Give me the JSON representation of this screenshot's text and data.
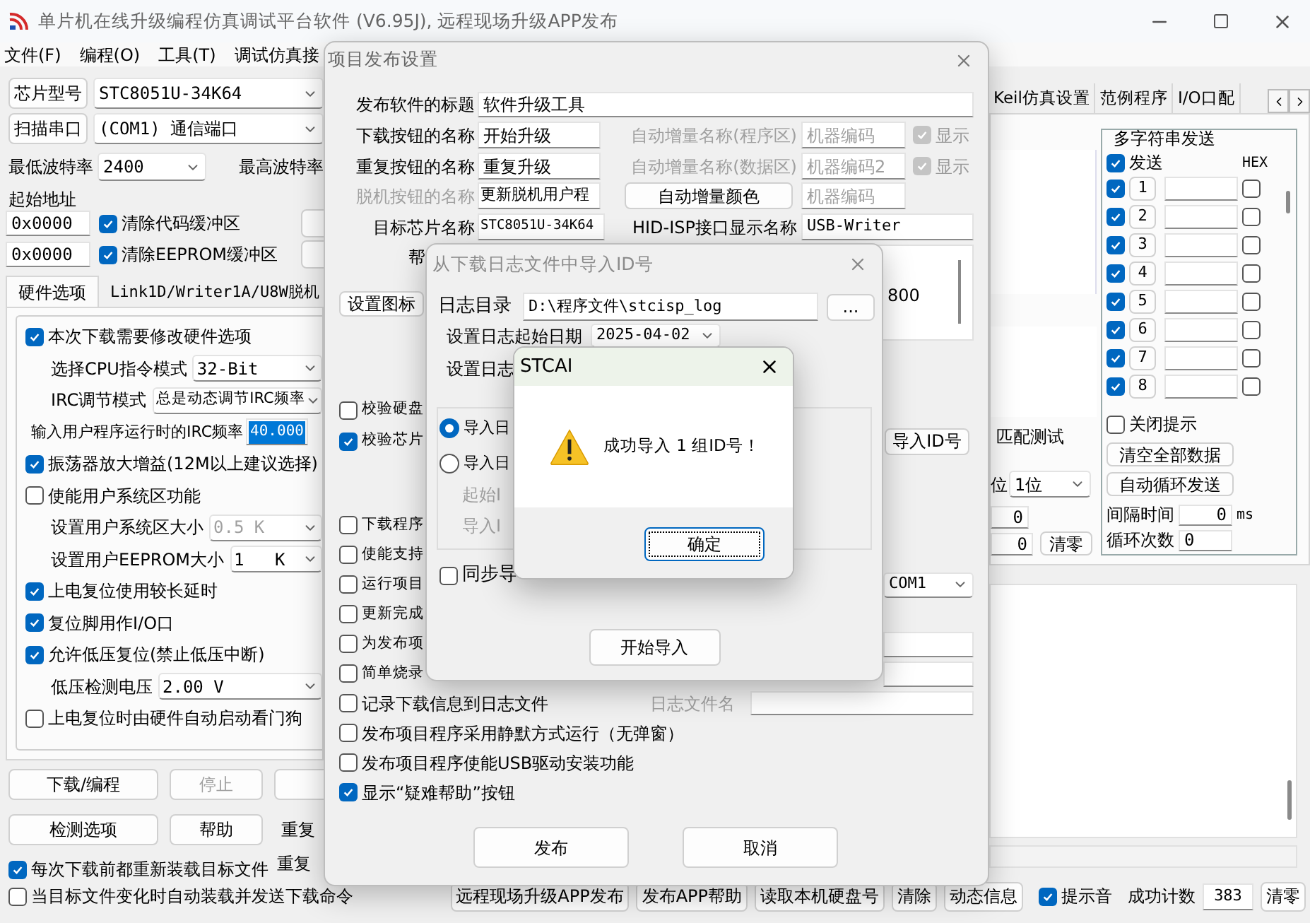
{
  "window": {
    "title": "单片机在线升级编程仿真调试平台软件 (V6.95J), 远程现场升级APP发布"
  },
  "menu": [
    "文件(F)",
    "编程(O)",
    "工具(T)",
    "调试仿真接"
  ],
  "left": {
    "chip": {
      "button": "芯片型号",
      "value": "STC8051U-34K64"
    },
    "port": {
      "button": "扫描串口",
      "value": "(COM1) 通信端口"
    },
    "min_baud": {
      "label": "最低波特率",
      "value": "2400"
    },
    "max_baud_label": "最高波特率",
    "start_address_label": "起始地址",
    "address_rows": [
      {
        "value": "0x0000",
        "label": "清除代码缓冲区",
        "checked": true
      },
      {
        "value": "0x0000",
        "label": "清除EEPROM缓冲区",
        "checked": true
      }
    ],
    "tabs": [
      {
        "label": "硬件选项",
        "selected": true
      },
      {
        "label": "Link1D/Writer1A/U8W脱机",
        "selected": false
      }
    ],
    "options": [
      {
        "kind": "checkbox",
        "label": "本次下载需要修改硬件选项",
        "checked": true
      },
      {
        "kind": "select",
        "label": "选择CPU指令模式",
        "value": "32-Bit",
        "disabled": false
      },
      {
        "kind": "select",
        "label": "IRC调节模式",
        "value": "总是动态调节IRC频率",
        "disabled": false
      },
      {
        "kind": "input",
        "label": "输入用户程序运行时的IRC频率",
        "value": "40.000",
        "selected": true
      },
      {
        "kind": "checkbox",
        "label": "振荡器放大增益(12M以上建议选择)",
        "checked": true
      },
      {
        "kind": "checkbox",
        "label": "使能用户系统区功能",
        "checked": false
      },
      {
        "kind": "select",
        "label": "设置用户系统区大小",
        "value": "0.5 K",
        "disabled": true
      },
      {
        "kind": "select",
        "label": "设置用户EEPROM大小",
        "value": "1   K",
        "disabled": false
      },
      {
        "kind": "checkbox",
        "label": "上电复位使用较长延时",
        "checked": true
      },
      {
        "kind": "checkbox",
        "label": "复位脚用作I/O口",
        "checked": true
      },
      {
        "kind": "checkbox",
        "label": "允许低压复位(禁止低压中断)",
        "checked": true
      },
      {
        "kind": "select",
        "label": "低压检测电压",
        "value": "2.00 V",
        "disabled": false
      },
      {
        "kind": "checkbox",
        "label": "上电复位时由硬件自动启动看门狗",
        "checked": false
      }
    ],
    "action_rows": [
      [
        {
          "label": "下载/编程",
          "disabled": false
        },
        {
          "label": "停止",
          "disabled": true
        }
      ],
      [
        {
          "label": "检测选项",
          "disabled": false
        },
        {
          "label": "帮助",
          "disabled": false
        }
      ]
    ],
    "side_labels": [
      "重复",
      "重复"
    ],
    "reload": {
      "label": "每次下载前都重新装载目标文件",
      "checked": true
    },
    "auto_send": {
      "label": "当目标文件变化时自动装载并发送下载命令",
      "checked": false
    }
  },
  "right": {
    "tabs": [
      {
        "label": "Keil仿真设置",
        "selected": false
      },
      {
        "label": "范例程序",
        "selected": false
      },
      {
        "label": "I/O口配",
        "selected": false
      }
    ],
    "match_label": "匹配测试",
    "bits_label": "位",
    "bits_value": "1位",
    "counters": [
      "0",
      "0"
    ],
    "clear_button": "清零",
    "multi": {
      "title": "多字符串发送",
      "send": {
        "label": "发送",
        "checked": true
      },
      "hex_label": "HEX",
      "rows": [
        {
          "number": "1",
          "checked": true,
          "hex": false
        },
        {
          "number": "2",
          "checked": true,
          "hex": false
        },
        {
          "number": "3",
          "checked": true,
          "hex": false
        },
        {
          "number": "4",
          "checked": true,
          "hex": false
        },
        {
          "number": "5",
          "checked": true,
          "hex": false
        },
        {
          "number": "6",
          "checked": true,
          "hex": false
        },
        {
          "number": "7",
          "checked": true,
          "hex": false
        },
        {
          "number": "8",
          "checked": true,
          "hex": false
        }
      ],
      "close_tip": {
        "label": "关闭提示",
        "checked": false
      },
      "buttons": [
        "清空全部数据",
        "自动循环发送"
      ],
      "interval": {
        "label": "间隔时间",
        "value": "0",
        "unit": "ms"
      },
      "loops": {
        "label": "循环次数",
        "value": "0"
      }
    }
  },
  "bottom_bar": {
    "buttons": [
      "远程现场升级APP发布",
      "发布APP帮助",
      "读取本机硬盘号",
      "清除",
      "动态信息"
    ],
    "sound": {
      "label": "提示音",
      "checked": true
    },
    "count_label": "成功计数",
    "count": "383",
    "clear": "清零"
  },
  "publish_dialog": {
    "title": "项目发布设置",
    "title_row": {
      "label": "发布软件的标题",
      "value": "软件升级工具"
    },
    "name_rows": [
      {
        "label": "下载按钮的名称",
        "value": "开始升级",
        "auto_label": "自动增量名称(程序区)",
        "auto_value": "机器编码",
        "show": {
          "label": "显示",
          "checked": true
        }
      },
      {
        "label": "重复按钮的名称",
        "value": "重复升级",
        "auto_label": "自动增量名称(数据区)",
        "auto_value": "机器编码2",
        "show": {
          "label": "显示",
          "checked": true
        }
      }
    ],
    "offline_row": {
      "label": "脱机按钮的名称",
      "value": "更新脱机用户程",
      "color_button": "自动增量颜色",
      "color_value": "机器编码"
    },
    "chip_row": {
      "label": "目标芯片名称",
      "value": "STC8051U-34K64",
      "hid_label": "HID-ISP接口显示名称",
      "hid_value": "USB-Writer"
    },
    "help_label": "帮",
    "help_text": "800",
    "icon_button": "设置图标",
    "verify": [
      {
        "label": "校验硬盘",
        "checked": false
      },
      {
        "label": "校验芯片",
        "checked": true
      }
    ],
    "import_button": "导入ID号",
    "options": [
      {
        "kind": "checkbox",
        "label": "下载程序",
        "checked": false
      },
      {
        "kind": "checkbox",
        "label": "使能支持",
        "checked": false
      },
      {
        "kind": "select",
        "label": "运行项目",
        "checked": false,
        "value": "COM1"
      },
      {
        "kind": "checkbox",
        "label": "更新完成",
        "checked": false
      },
      {
        "kind": "field",
        "label": "为发布项",
        "checked": false
      },
      {
        "kind": "field",
        "label": "简单烧录",
        "checked": false
      }
    ],
    "log": {
      "label": "记录下载信息到日志文件",
      "checked": false,
      "file_label": "日志文件名"
    },
    "more": [
      {
        "label": "发布项目程序采用静默方式运行（无弹窗）",
        "checked": false
      },
      {
        "label": "发布项目程序使能USB驱动安装功能",
        "checked": false
      },
      {
        "label": "显示“疑难帮助”按钮",
        "checked": true
      }
    ],
    "buttons": [
      "发布",
      "取消"
    ]
  },
  "import_dialog": {
    "title": "从下载日志文件中导入ID号",
    "dir_label": "日志目录",
    "dir_value": "D:\\程序文件\\stcisp_log",
    "browse": "...",
    "start_date_label": "设置日志起始日期",
    "start_date": "2025-04-02",
    "end_label": "设置日志",
    "modes": [
      {
        "label": "导入日",
        "selected": true
      },
      {
        "label": "导入日",
        "selected": false
      }
    ],
    "id_labels": [
      "起始I",
      "导入I"
    ],
    "sync": {
      "label": "同步导",
      "checked": false
    },
    "start_button": "开始导入"
  },
  "alert": {
    "title": "STCAI",
    "message": "成功导入 1 组ID号！",
    "ok": "确定"
  }
}
